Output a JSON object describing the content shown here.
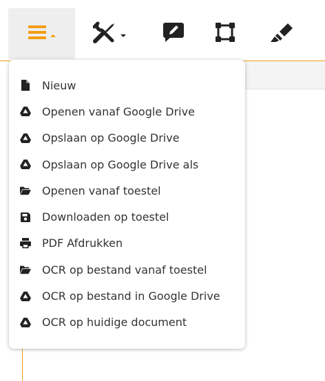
{
  "colors": {
    "accent": "#f39c12",
    "icon_dark": "#222222",
    "text": "#333333",
    "active_bg": "#eeeeee"
  },
  "toolbar": {
    "buttons": [
      {
        "name": "hamburger-menu-button",
        "icon": "hamburger-icon",
        "has_caret": true,
        "active": true
      },
      {
        "name": "tools-button",
        "icon": "tools-icon",
        "has_caret": true,
        "active": false
      },
      {
        "name": "comment-edit-button",
        "icon": "comment-edit-icon",
        "has_caret": false,
        "active": false
      },
      {
        "name": "selection-box-button",
        "icon": "selection-box-icon",
        "has_caret": false,
        "active": false
      },
      {
        "name": "highlighter-button",
        "icon": "highlighter-icon",
        "has_caret": false,
        "active": false
      }
    ]
  },
  "menu": {
    "items": [
      {
        "label": "Nieuw",
        "icon": "file-icon"
      },
      {
        "label": "Openen vanaf Google Drive",
        "icon": "google-drive-icon"
      },
      {
        "label": "Opslaan op Google Drive",
        "icon": "google-drive-icon"
      },
      {
        "label": "Opslaan op Google Drive als",
        "icon": "google-drive-icon"
      },
      {
        "label": "Openen vanaf toestel",
        "icon": "folder-open-icon"
      },
      {
        "label": "Downloaden op toestel",
        "icon": "save-icon"
      },
      {
        "label": "PDF Afdrukken",
        "icon": "print-icon"
      },
      {
        "label": "OCR op bestand vanaf toestel",
        "icon": "folder-open-icon"
      },
      {
        "label": "OCR op bestand in Google Drive",
        "icon": "google-drive-icon"
      },
      {
        "label": "OCR op huidige document",
        "icon": "google-drive-icon"
      }
    ]
  }
}
